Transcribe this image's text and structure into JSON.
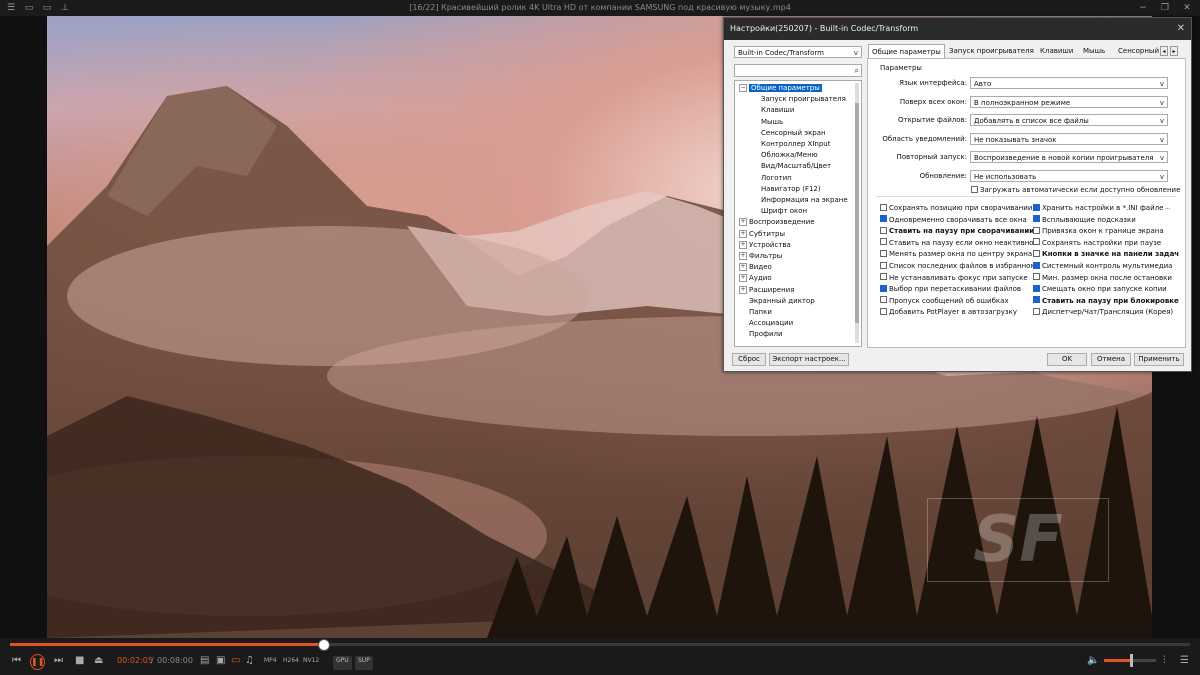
{
  "window": {
    "title": "[16/22] Красивейший ролик 4K Ultra HD от компании SAMSUNG под красивую музыку.mp4"
  },
  "watermark": "SF",
  "player": {
    "time_current": "00:02:05",
    "time_separator": "/",
    "time_total": "00:08:00",
    "progress": 0.265,
    "volume": 0.52,
    "format_tags": [
      "MP4",
      "H264",
      "NV12"
    ],
    "hw_tags": [
      "GPU",
      "SUP"
    ]
  },
  "dialog": {
    "title": "Настройки(250207) - Built-in Codec/Transform",
    "profile_select": "Built-in Codec/Transform",
    "tree": [
      {
        "label": "Общие параметры",
        "level": 0,
        "expander": "−",
        "selected": true
      },
      {
        "label": "Запуск проигрывателя",
        "level": 1
      },
      {
        "label": "Клавиши",
        "level": 1
      },
      {
        "label": "Мышь",
        "level": 1
      },
      {
        "label": "Сенсорный экран",
        "level": 1
      },
      {
        "label": "Контроллер XInput",
        "level": 1
      },
      {
        "label": "Обложка/Меню",
        "level": 1
      },
      {
        "label": "Вид/Масштаб/Цвет",
        "level": 1
      },
      {
        "label": "Логотип",
        "level": 1
      },
      {
        "label": "Навигатор (F12)",
        "level": 1
      },
      {
        "label": "Информация на экране",
        "level": 1
      },
      {
        "label": "Шрифт окон",
        "level": 1
      },
      {
        "label": "Воспроизведение",
        "level": 0,
        "expander": "+"
      },
      {
        "label": "Субтитры",
        "level": 0,
        "expander": "+"
      },
      {
        "label": "Устройства",
        "level": 0,
        "expander": "+"
      },
      {
        "label": "Фильтры",
        "level": 0,
        "expander": "+"
      },
      {
        "label": "Видео",
        "level": 0,
        "expander": "+"
      },
      {
        "label": "Аудио",
        "level": 0,
        "expander": "+"
      },
      {
        "label": "Расширения",
        "level": 0,
        "expander": "+"
      },
      {
        "label": "Экранный диктор",
        "level": 0
      },
      {
        "label": "Папки",
        "level": 0
      },
      {
        "label": "Ассоциации",
        "level": 0
      },
      {
        "label": "Профили",
        "level": 0
      }
    ],
    "tabs": [
      "Общие параметры",
      "Запуск проигрывателя",
      "Клавиши",
      "Мышь",
      "Сенсорный"
    ],
    "tab_prev": "◂",
    "tab_next": "▸",
    "group_label": "Параметры",
    "fields": [
      {
        "label": "Язык интерфейса:",
        "value": "Авто"
      },
      {
        "label": "Поверх всех окон:",
        "value": "В полноэкранном режиме"
      },
      {
        "label": "Открытие файлов:",
        "value": "Добавлять в список все файлы"
      },
      {
        "label": "Область уведомлений:",
        "value": "Не показывать значок"
      },
      {
        "label": "Повторный запуск:",
        "value": "Воспроизведение в новой копии проигрывателя"
      },
      {
        "label": "Обновление:",
        "value": "Не использовать"
      }
    ],
    "auto_update": {
      "label": "Загружать автоматически если доступно обновление",
      "checked": false
    },
    "checkboxes_left": [
      {
        "label": "Сохранять позицию при сворачивании",
        "checked": false
      },
      {
        "label": "Одновременно сворачивать все окна",
        "checked": true
      },
      {
        "label": "Ставить на паузу при сворачивании",
        "checked": false,
        "bold": true
      },
      {
        "label": "Ставить на паузу если окно неактивно",
        "checked": false
      },
      {
        "label": "Менять размер окна по центру экрана",
        "checked": false
      },
      {
        "label": "Список последних файлов в избранном",
        "checked": false
      },
      {
        "label": "Не устанавливать фокус при запуске",
        "checked": false
      },
      {
        "label": "Выбор при перетаскивании файлов",
        "checked": true
      },
      {
        "label": "Пропуск сообщений об ошибках",
        "checked": false
      },
      {
        "label": "Добавить PotPlayer в автозагрузку",
        "checked": false
      }
    ],
    "checkboxes_right": [
      {
        "label": "Хранить настройки в *.INI файле",
        "checked": true
      },
      {
        "label": "Всплывающие подсказки",
        "checked": true
      },
      {
        "label": "Привязка окон к границе экрана",
        "checked": false
      },
      {
        "label": "Сохранять настройки при паузе",
        "checked": false
      },
      {
        "label": "Кнопки в значке на панели задач",
        "checked": false,
        "bold": true
      },
      {
        "label": "Системный контроль мультимедиа",
        "checked": true
      },
      {
        "label": "Мин. размер окна после остановки",
        "checked": false
      },
      {
        "label": "Смещать окно при запуске копии",
        "checked": true
      },
      {
        "label": "Ставить на паузу при блокировке",
        "checked": true,
        "bold": true
      },
      {
        "label": "Диспетчер/Чат/Трансляция (Корея)",
        "checked": false
      }
    ],
    "more": "...",
    "buttons": {
      "reset": "Сброс",
      "export": "Экспорт настроек...",
      "ok": "OK",
      "cancel": "Отмена",
      "apply": "Применить"
    }
  }
}
